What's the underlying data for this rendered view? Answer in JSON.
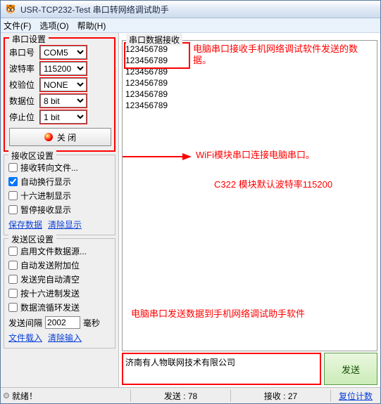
{
  "window": {
    "title": "USR-TCP232-Test 串口转网络调试助手"
  },
  "menu": {
    "file": "文件(F)",
    "options": "选项(O)",
    "help": "帮助(H)"
  },
  "portGroup": {
    "title": "串口设置",
    "port": {
      "label": "串口号",
      "value": "COM5"
    },
    "baud": {
      "label": "波特率",
      "value": "115200"
    },
    "parity": {
      "label": "校验位",
      "value": "NONE"
    },
    "databits": {
      "label": "数据位",
      "value": "8 bit"
    },
    "stopbits": {
      "label": "停止位",
      "value": "1 bit"
    },
    "closeBtn": "关 闭"
  },
  "recvGroup": {
    "title": "接收区设置",
    "items": [
      "接收转向文件...",
      "自动换行显示",
      "十六进制显示",
      "暂停接收显示"
    ],
    "links": [
      "保存数据",
      "清除显示"
    ]
  },
  "sendGroup": {
    "title": "发送区设置",
    "items": [
      "启用文件数据源...",
      "自动发送附加位",
      "发送完自动清空",
      "按十六进制发送",
      "数据流循环发送"
    ],
    "interval": {
      "label": "发送间隔",
      "value": "2002",
      "unit": "毫秒"
    },
    "links": [
      "文件载入",
      "清除输入"
    ]
  },
  "recvArea": {
    "title": "串口数据接收",
    "lines": [
      "123456789",
      "123456789",
      "123456789",
      "123456789",
      "123456789",
      "123456789"
    ]
  },
  "annotations": {
    "recv": "电脑串口接收手机网络调试软件发送的数据。",
    "wifi": "WiFi模块串口连接电脑串口。",
    "baud": "C322 模块默认波特率115200",
    "send": "电脑串口发送数据到手机网络调试助手软件"
  },
  "sendArea": {
    "text": "济南有人物联网技术有限公司",
    "button": "发送"
  },
  "status": {
    "ready": "就绪！",
    "send": "发送 : 78",
    "recv": "接收 : 27",
    "reset": "复位计数"
  }
}
